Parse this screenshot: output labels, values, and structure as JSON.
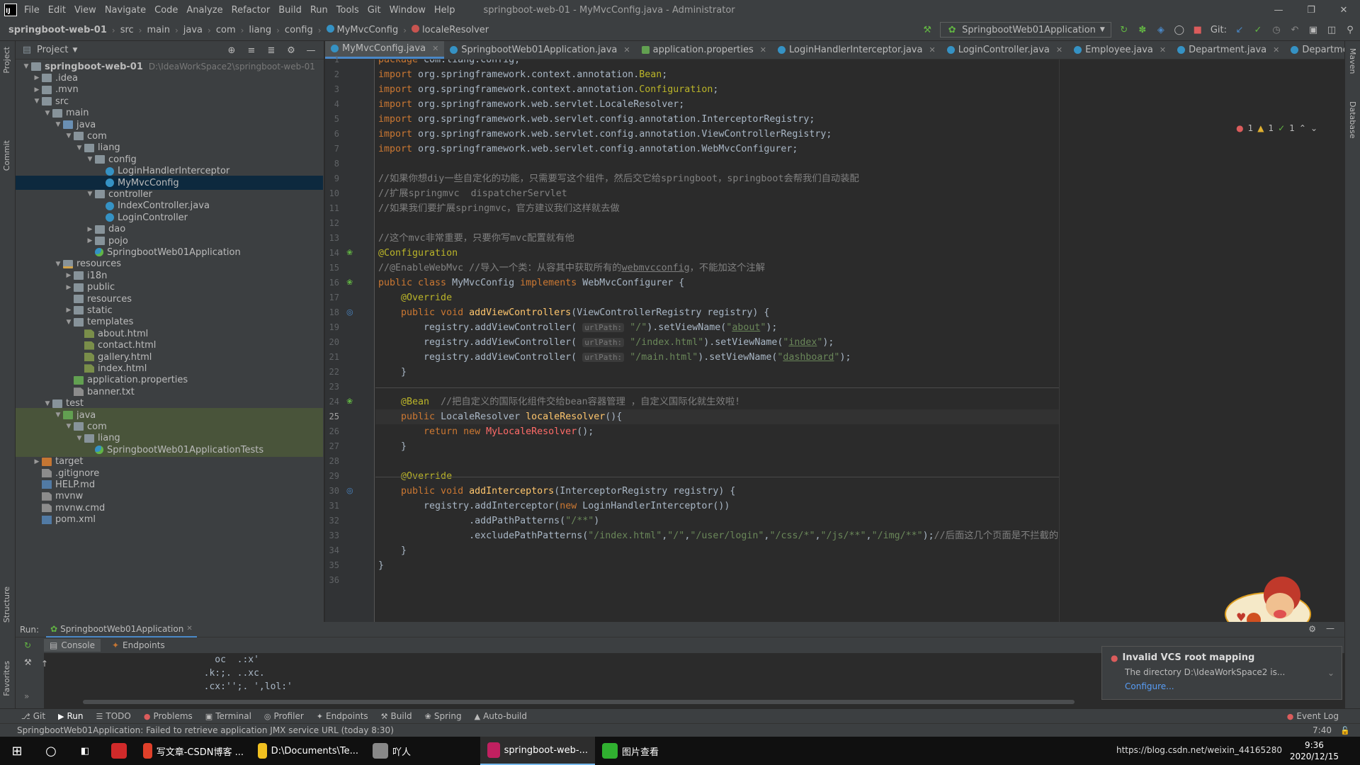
{
  "window": {
    "title": "springboot-web-01 - MyMvcConfig.java - Administrator",
    "menu": [
      "File",
      "Edit",
      "View",
      "Navigate",
      "Code",
      "Analyze",
      "Refactor",
      "Build",
      "Run",
      "Tools",
      "Git",
      "Window",
      "Help"
    ]
  },
  "breadcrumb": [
    "springboot-web-01",
    "src",
    "main",
    "java",
    "com",
    "liang",
    "config",
    "MyMvcConfig",
    "localeResolver"
  ],
  "run_config": "SpringbootWeb01Application",
  "git_label": "Git:",
  "project_panel": {
    "title": "Project",
    "root_name": "springboot-web-01",
    "root_path": "D:\\IdeaWorkSpace2\\springboot-web-01",
    "tree": [
      {
        "label": ".idea",
        "depth": 1,
        "arrow": ">",
        "icon": "folder"
      },
      {
        "label": ".mvn",
        "depth": 1,
        "arrow": ">",
        "icon": "folder"
      },
      {
        "label": "src",
        "depth": 1,
        "arrow": "v",
        "icon": "folder"
      },
      {
        "label": "main",
        "depth": 2,
        "arrow": "v",
        "icon": "folder"
      },
      {
        "label": "java",
        "depth": 3,
        "arrow": "v",
        "icon": "folder-blue"
      },
      {
        "label": "com",
        "depth": 4,
        "arrow": "v",
        "icon": "folder"
      },
      {
        "label": "liang",
        "depth": 5,
        "arrow": "v",
        "icon": "folder"
      },
      {
        "label": "config",
        "depth": 6,
        "arrow": "v",
        "icon": "folder"
      },
      {
        "label": "LoginHandlerInterceptor",
        "depth": 7,
        "arrow": "",
        "icon": "class"
      },
      {
        "label": "MyMvcConfig",
        "depth": 7,
        "arrow": "",
        "icon": "class",
        "selected": true
      },
      {
        "label": "controller",
        "depth": 6,
        "arrow": "v",
        "icon": "folder"
      },
      {
        "label": "IndexController.java",
        "depth": 7,
        "arrow": "",
        "icon": "java-file"
      },
      {
        "label": "LoginController",
        "depth": 7,
        "arrow": "",
        "icon": "class"
      },
      {
        "label": "dao",
        "depth": 6,
        "arrow": ">",
        "icon": "folder"
      },
      {
        "label": "pojo",
        "depth": 6,
        "arrow": ">",
        "icon": "folder"
      },
      {
        "label": "SpringbootWeb01Application",
        "depth": 6,
        "arrow": "",
        "icon": "spring-class"
      },
      {
        "label": "resources",
        "depth": 3,
        "arrow": "v",
        "icon": "folder-res"
      },
      {
        "label": "i18n",
        "depth": 4,
        "arrow": ">",
        "icon": "folder"
      },
      {
        "label": "public",
        "depth": 4,
        "arrow": ">",
        "icon": "folder"
      },
      {
        "label": "resources",
        "depth": 4,
        "arrow": "",
        "icon": "folder"
      },
      {
        "label": "static",
        "depth": 4,
        "arrow": ">",
        "icon": "folder"
      },
      {
        "label": "templates",
        "depth": 4,
        "arrow": "v",
        "icon": "folder"
      },
      {
        "label": "about.html",
        "depth": 5,
        "arrow": "",
        "icon": "html"
      },
      {
        "label": "contact.html",
        "depth": 5,
        "arrow": "",
        "icon": "html"
      },
      {
        "label": "gallery.html",
        "depth": 5,
        "arrow": "",
        "icon": "html"
      },
      {
        "label": "index.html",
        "depth": 5,
        "arrow": "",
        "icon": "html"
      },
      {
        "label": "application.properties",
        "depth": 4,
        "arrow": "",
        "icon": "properties"
      },
      {
        "label": "banner.txt",
        "depth": 4,
        "arrow": "",
        "icon": "txt"
      },
      {
        "label": "test",
        "depth": 2,
        "arrow": "v",
        "icon": "folder"
      },
      {
        "label": "java",
        "depth": 3,
        "arrow": "v",
        "icon": "folder-green",
        "test": true
      },
      {
        "label": "com",
        "depth": 4,
        "arrow": "v",
        "icon": "folder",
        "test": true
      },
      {
        "label": "liang",
        "depth": 5,
        "arrow": "v",
        "icon": "folder",
        "test": true
      },
      {
        "label": "SpringbootWeb01ApplicationTests",
        "depth": 6,
        "arrow": "",
        "icon": "spring-class",
        "test": true
      },
      {
        "label": "target",
        "depth": 1,
        "arrow": ">",
        "icon": "folder-orange"
      },
      {
        "label": ".gitignore",
        "depth": 1,
        "arrow": "",
        "icon": "txt"
      },
      {
        "label": "HELP.md",
        "depth": 1,
        "arrow": "",
        "icon": "md"
      },
      {
        "label": "mvnw",
        "depth": 1,
        "arrow": "",
        "icon": "txt"
      },
      {
        "label": "mvnw.cmd",
        "depth": 1,
        "arrow": "",
        "icon": "txt"
      },
      {
        "label": "pom.xml",
        "depth": 1,
        "arrow": "",
        "icon": "md"
      }
    ]
  },
  "editor_tabs": [
    {
      "label": "MyMvcConfig.java",
      "icon": "class",
      "active": true
    },
    {
      "label": "SpringbootWeb01Application.java",
      "icon": "class"
    },
    {
      "label": "application.properties",
      "icon": "properties"
    },
    {
      "label": "LoginHandlerInterceptor.java",
      "icon": "class"
    },
    {
      "label": "LoginController.java",
      "icon": "class"
    },
    {
      "label": "Employee.java",
      "icon": "class"
    },
    {
      "label": "Department.java",
      "icon": "class"
    },
    {
      "label": "DepartmentDao.java",
      "icon": "class"
    }
  ],
  "inspections": {
    "errors": "1",
    "warnings": "1",
    "ok": "1"
  },
  "code_lines": [
    [
      [
        "kw",
        "package "
      ],
      [
        "",
        "com.liang.config;"
      ]
    ],
    [
      [
        "kw",
        "import "
      ],
      [
        "",
        "org.springframework.context.annotation."
      ],
      [
        "an",
        "Bean"
      ],
      [
        "",
        ";"
      ]
    ],
    [
      [
        "kw",
        "import "
      ],
      [
        "",
        "org.springframework.context.annotation."
      ],
      [
        "an",
        "Configuration"
      ],
      [
        "",
        ";"
      ]
    ],
    [
      [
        "kw",
        "import "
      ],
      [
        "",
        "org.springframework.web.servlet.LocaleResolver;"
      ]
    ],
    [
      [
        "kw",
        "import "
      ],
      [
        "",
        "org.springframework.web.servlet.config.annotation.InterceptorRegistry;"
      ]
    ],
    [
      [
        "kw",
        "import "
      ],
      [
        "",
        "org.springframework.web.servlet.config.annotation.ViewControllerRegistry;"
      ]
    ],
    [
      [
        "kw",
        "import "
      ],
      [
        "",
        "org.springframework.web.servlet.config.annotation.WebMvcConfigurer;"
      ]
    ],
    [],
    [
      [
        "cm",
        "//如果你想diy一些自定化的功能，只需要写这个组件，然后交它给springboot，springboot会帮我们自动装配"
      ]
    ],
    [
      [
        "cm",
        "//扩展springmvc  dispatcherServlet"
      ]
    ],
    [
      [
        "cm",
        "//如果我们要扩展springmvc，官方建议我们这样就去做"
      ]
    ],
    [],
    [
      [
        "cm",
        "//这个mvc非常重要，只要你写mvc配置就有他"
      ]
    ],
    [
      [
        "an",
        "@Configuration"
      ]
    ],
    [
      [
        "cm",
        "//@EnableWebMvc //导入一个类：从容其中获取所有的"
      ],
      [
        "cm ul",
        "webmvcconfig"
      ],
      [
        "cm",
        "，不能加这个注解"
      ]
    ],
    [
      [
        "kw",
        "public class "
      ],
      [
        "",
        "MyMvcConfig "
      ],
      [
        "kw",
        "implements "
      ],
      [
        "",
        "WebMvcConfigurer {"
      ]
    ],
    [
      [
        "an",
        "    @Override"
      ]
    ],
    [
      [
        "kw",
        "    public void "
      ],
      [
        "fn",
        "addViewControllers"
      ],
      [
        "",
        "(ViewControllerRegistry registry) {"
      ]
    ],
    [
      [
        "",
        "        registry.addViewController( "
      ],
      [
        "hint",
        "urlPath:"
      ],
      [
        "str",
        " \"/\""
      ],
      [
        "",
        ").setViewName("
      ],
      [
        "str",
        "\""
      ],
      [
        "str ul",
        "about"
      ],
      [
        "str",
        "\""
      ],
      [
        "",
        ");"
      ]
    ],
    [
      [
        "",
        "        registry.addViewController( "
      ],
      [
        "hint",
        "urlPath:"
      ],
      [
        "str",
        " \"/index.html\""
      ],
      [
        "",
        ").setViewName("
      ],
      [
        "str",
        "\""
      ],
      [
        "str ul",
        "index"
      ],
      [
        "str",
        "\""
      ],
      [
        "",
        ");"
      ]
    ],
    [
      [
        "",
        "        registry.addViewController( "
      ],
      [
        "hint",
        "urlPath:"
      ],
      [
        "str",
        " \"/main.html\""
      ],
      [
        "",
        ").setViewName("
      ],
      [
        "str",
        "\""
      ],
      [
        "str ul",
        "dashboard"
      ],
      [
        "str",
        "\""
      ],
      [
        "",
        ");"
      ]
    ],
    [
      [
        "",
        "    }"
      ]
    ],
    [],
    [
      [
        "an",
        "    @Bean  "
      ],
      [
        "cm",
        "//把自定义的国际化组件交给bean容器管理 ，自定义国际化就生效啦!"
      ]
    ],
    [
      [
        "kw",
        "    public "
      ],
      [
        "",
        "LocaleResolver "
      ],
      [
        "fn",
        "localeResolver"
      ],
      [
        "",
        "(){"
      ]
    ],
    [
      [
        "kw",
        "        return new "
      ],
      [
        "red",
        "MyLocaleResolver"
      ],
      [
        "",
        "();"
      ]
    ],
    [
      [
        "",
        "    }"
      ]
    ],
    [],
    [
      [
        "an",
        "    @Override"
      ]
    ],
    [
      [
        "kw",
        "    public void "
      ],
      [
        "fn",
        "addInterceptors"
      ],
      [
        "",
        "(InterceptorRegistry registry) {"
      ]
    ],
    [
      [
        "",
        "        registry.addInterceptor("
      ],
      [
        "kw",
        "new "
      ],
      [
        "",
        "LoginHandlerInterceptor())"
      ]
    ],
    [
      [
        "",
        "                .addPathPatterns("
      ],
      [
        "str",
        "\"/**\""
      ],
      [
        "",
        ")"
      ]
    ],
    [
      [
        "",
        "                .excludePathPatterns("
      ],
      [
        "str",
        "\"/index.html\""
      ],
      [
        "",
        ","
      ],
      [
        "str",
        "\"/\""
      ],
      [
        "",
        ","
      ],
      [
        "str",
        "\"/user/login\""
      ],
      [
        "",
        ","
      ],
      [
        "str",
        "\"/css/*\""
      ],
      [
        "",
        ","
      ],
      [
        "str",
        "\"/js/**\""
      ],
      [
        "",
        ","
      ],
      [
        "str",
        "\"/img/**\""
      ],
      [
        "",
        ");"
      ],
      [
        "cm",
        "//后面这几个页面是不拦截的"
      ]
    ],
    [
      [
        "",
        "    }"
      ]
    ],
    [
      [
        "",
        "}"
      ]
    ],
    []
  ],
  "current_line": 25,
  "run_panel": {
    "label": "Run:",
    "tab": "SpringbootWeb01Application",
    "subtabs": [
      "Console",
      "Endpoints"
    ],
    "console_lines": [
      "    oc  .:x'",
      "  .k:;. ..xc.",
      "  .cx:'';. ',lol:'"
    ]
  },
  "notification": {
    "title": "Invalid VCS root mapping",
    "body": "The directory D:\\IdeaWorkSpace2 is...",
    "link": "Configure..."
  },
  "tool_windows": [
    "Git",
    "Run",
    "TODO",
    "Problems",
    "Terminal",
    "Profiler",
    "Endpoints",
    "Build",
    "Spring",
    "Auto-build"
  ],
  "event_log": "Event Log",
  "left_strip": [
    "Project",
    "Commit",
    "Structure",
    "Favorites"
  ],
  "right_strip": [
    "Maven",
    "Database"
  ],
  "status": {
    "message": "SpringbootWeb01Application: Failed to retrieve application JMX service URL (today 8:30)",
    "position": "7:40"
  },
  "taskbar": {
    "items": [
      {
        "label": "写文章-CSDN博客 ...",
        "color": "#e0402a"
      },
      {
        "label": "D:\\Documents\\Te...",
        "color": "#f0c020"
      },
      {
        "label": "吖人",
        "color": "#888888"
      },
      {
        "label": "springboot-web-...",
        "color": "#c02060",
        "active": true
      },
      {
        "label": "图片查看",
        "color": "#30b030"
      }
    ],
    "time": "9:36",
    "date": "2020/12/15",
    "tray_text": "https://blog.csdn.net/weixin_44165280"
  }
}
